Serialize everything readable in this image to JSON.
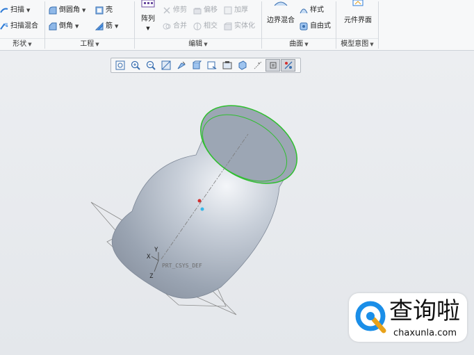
{
  "ribbon": {
    "shape_group": {
      "footer": "形状",
      "sweep": "扫描",
      "swept_blend": "扫描混合"
    },
    "engineering_group": {
      "footer": "工程",
      "round": "倒圆角",
      "chamfer": "倒角",
      "shell": "壳",
      "rib": "筋"
    },
    "editing_group": {
      "footer": "编辑",
      "pattern": "阵列",
      "trim": "修剪",
      "offset": "偏移",
      "thicken": "加厚",
      "merge": "合并",
      "intersect": "相交",
      "solidify": "实体化"
    },
    "surfaces_group": {
      "footer": "曲面",
      "boundary_blend": "边界混合",
      "style": "样式",
      "freestyle": "自由式"
    },
    "model_intent_group": {
      "footer": "模型意图",
      "component_interface": "元件界面"
    }
  },
  "view_toolbar": {
    "icons": [
      "refit-icon",
      "zoom-in-icon",
      "zoom-out-icon",
      "repaint-icon",
      "perspective-icon",
      "display-style-icon",
      "saved-orientations-icon",
      "view-manager-icon",
      "section-icon",
      "datum-display-icon",
      "annotation-display-icon",
      "spin-center-icon"
    ],
    "active_icon": "spin-center-icon"
  },
  "model": {
    "csys_label": "PRT_CSYS_DEF",
    "axis_x": "X",
    "axis_y": "Y",
    "axis_z": "Z",
    "colors": {
      "body": "#aeb7c4",
      "highlight": "#2fbf2f",
      "datum": "#8a8a8a"
    }
  },
  "watermark": {
    "title": "查询啦",
    "url": "chaxunla.com",
    "accent": "#1a8ee8"
  }
}
